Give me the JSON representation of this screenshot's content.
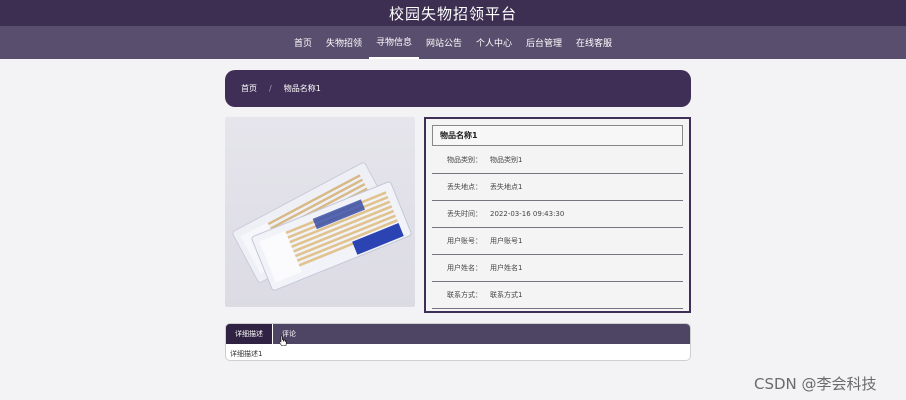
{
  "header": {
    "title": "校园失物招领平台"
  },
  "nav": {
    "items": [
      {
        "label": "首页"
      },
      {
        "label": "失物招领"
      },
      {
        "label": "寻物信息"
      },
      {
        "label": "网站公告"
      },
      {
        "label": "个人中心"
      },
      {
        "label": "后台管理"
      },
      {
        "label": "在线客服"
      }
    ],
    "active": "寻物信息"
  },
  "breadcrumb": {
    "home": "首页",
    "separator": "/",
    "current": "物品名称1"
  },
  "item": {
    "name": "物品名称1",
    "fields": [
      {
        "label": "物品类别：",
        "value": "物品类别1"
      },
      {
        "label": "丢失地点：",
        "value": "丢失地点1"
      },
      {
        "label": "丢失时间：",
        "value": "2022-03-16 09:43:30"
      },
      {
        "label": "用户账号：",
        "value": "用户账号1"
      },
      {
        "label": "用户姓名：",
        "value": "用户姓名1"
      },
      {
        "label": "联系方式：",
        "value": "联系方式1"
      }
    ]
  },
  "tabs": {
    "items": [
      {
        "label": "详细描述"
      },
      {
        "label": "评论"
      }
    ],
    "active": "详细描述",
    "content": "详细描述1"
  },
  "watermark": "CSDN @李会科技",
  "colors": {
    "brand": "#3d2f52",
    "nav": "#5a4e6e",
    "accent": "#3f2f56"
  }
}
